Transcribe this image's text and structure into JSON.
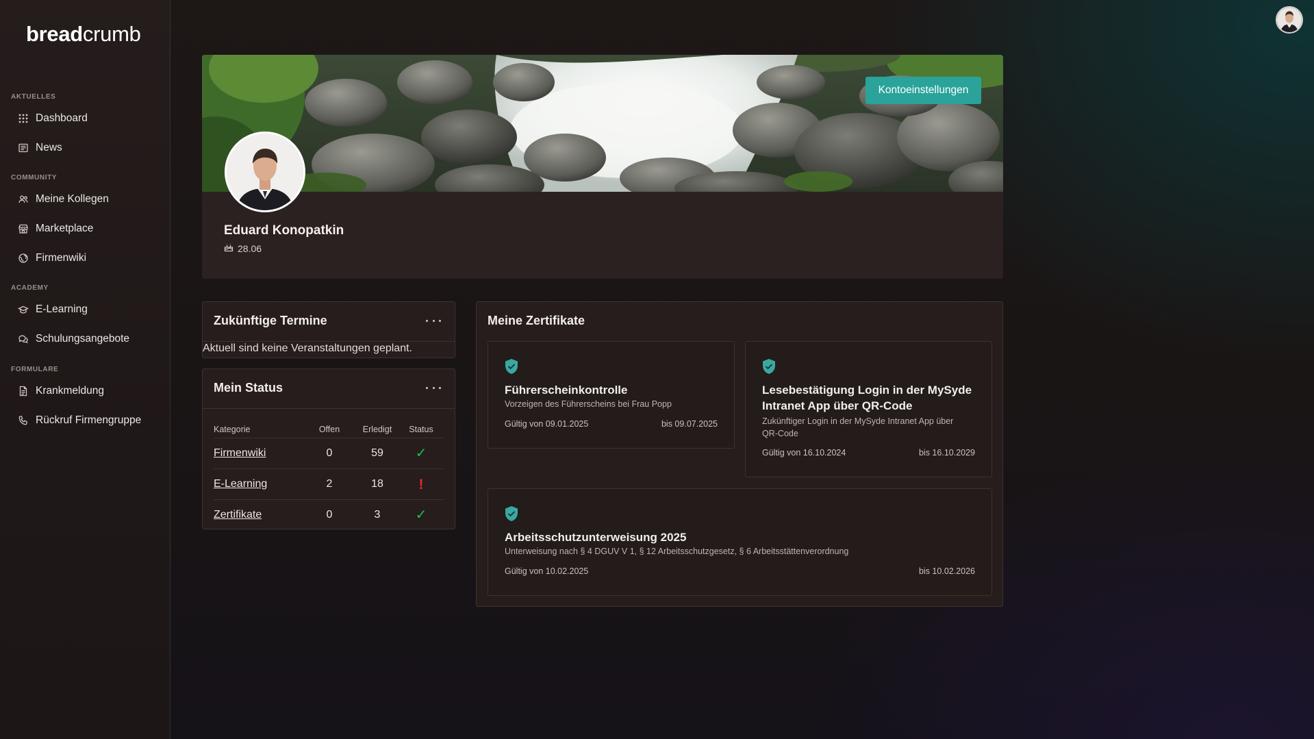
{
  "app": {
    "logo_bold": "bread",
    "logo_light": "crumb"
  },
  "sidebar": {
    "sections": [
      {
        "label": "AKTUELLES",
        "items": [
          {
            "label": "Dashboard",
            "icon": "grid-icon"
          },
          {
            "label": "News",
            "icon": "newspaper-icon"
          }
        ]
      },
      {
        "label": "COMMUNITY",
        "items": [
          {
            "label": "Meine Kollegen",
            "icon": "users-icon"
          },
          {
            "label": "Marketplace",
            "icon": "store-icon"
          },
          {
            "label": "Firmenwiki",
            "icon": "globe-icon"
          }
        ]
      },
      {
        "label": "ACADEMY",
        "items": [
          {
            "label": "E-Learning",
            "icon": "graduation-cap-icon"
          },
          {
            "label": "Schulungsangebote",
            "icon": "chat-bubbles-icon"
          }
        ]
      },
      {
        "label": "FORMULARE",
        "items": [
          {
            "label": "Krankmeldung",
            "icon": "document-icon"
          },
          {
            "label": "Rückruf Firmengruppe",
            "icon": "phone-icon"
          }
        ]
      }
    ]
  },
  "profile": {
    "name": "Eduard Konopatkin",
    "birthday": "28.06",
    "settings_button": "Kontoeinstellungen"
  },
  "termine": {
    "title": "Zukünftige Termine",
    "empty_text": "Aktuell sind keine Veranstaltungen geplant."
  },
  "status": {
    "title": "Mein Status",
    "headers": {
      "category": "Kategorie",
      "open": "Offen",
      "done": "Erledigt",
      "status": "Status"
    },
    "rows": [
      {
        "category": "Firmenwiki",
        "open": "0",
        "done": "59",
        "status": "ok"
      },
      {
        "category": "E-Learning",
        "open": "2",
        "done": "18",
        "status": "warning"
      },
      {
        "category": "Zertifikate",
        "open": "0",
        "done": "3",
        "status": "ok"
      }
    ]
  },
  "certificates": {
    "title": "Meine Zertifikate",
    "items": [
      {
        "title": "Führerscheinkontrolle",
        "description": "Vorzeigen des Führerscheins bei Frau Popp",
        "valid_from": "Gültig von 09.01.2025",
        "valid_to": "bis 09.07.2025"
      },
      {
        "title_line1": "Lesebestätigung Login in der MySyde",
        "title_line2": "Intranet App über QR-Code",
        "description_line1": "Zukünftiger Login in der MySyde Intranet App über",
        "description_line2": "QR-Code",
        "valid_from": "Gültig von 16.10.2024",
        "valid_to": "bis 16.10.2029"
      },
      {
        "title": "Arbeitsschutzunterweisung 2025",
        "description": "Unterweisung nach § 4 DGUV V 1, § 12 Arbeitsschutzgesetz, § 6 Arbeitsstättenverordnung",
        "valid_from": "Gültig von 10.02.2025",
        "valid_to": "bis 10.02.2026"
      }
    ]
  },
  "colors": {
    "accent": "#2aa39a",
    "ok": "#1bbf49",
    "warning": "#e82a2a",
    "shield": "#3aa8a0"
  }
}
